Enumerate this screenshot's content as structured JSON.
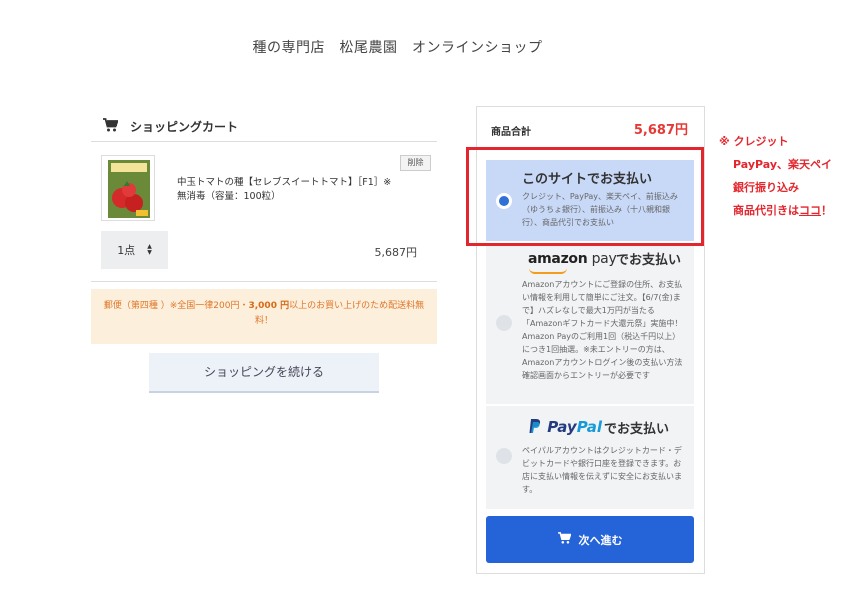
{
  "store": {
    "title": "種の専門店　松尾農園　オンラインショップ"
  },
  "cart": {
    "title": "ショッピングカート",
    "item": {
      "name": "中玉トマトの種【セレブスイートトマト】［F1］※無消毒（容量：100粒）",
      "delete_label": "削除",
      "quantity": "1点",
      "price": "5,687円"
    },
    "shipping_note_pre": "郵便（第四種 ）※全国一律200円・",
    "shipping_note_bold": "3,000 円",
    "shipping_note_post": "以上のお買い上げのため配送料無料！",
    "continue_label": "ショッピングを続ける"
  },
  "summary": {
    "subtotal_label": "商品合計",
    "subtotal_value": "5,687円"
  },
  "payment": {
    "site": {
      "heading": "このサイトでお支払い",
      "description": "クレジット、PayPay、楽天ペイ、前振込み（ゆうちょ銀行）、前振込み（十八親和銀行）、商品代引でお支払い",
      "selected": true
    },
    "amazon": {
      "logo_amazon": "amazon",
      "logo_pay": " pay",
      "heading": "でお支払い",
      "description": "Amazonアカウントにご登録の住所、お支払い情報を利用して簡単にご注文。【6/7(金)まで】ハズレなしで最大1万円が当たる「Amazonギフトカード大還元祭」実施中！Amazon Payのご利用1回（税込千円以上）につき1回抽選。※未エントリーの方は、Amazonアカウントログイン後の支払い方法確認画面からエントリーが必要です",
      "selected": false
    },
    "paypal": {
      "logo_pay": "Pay",
      "logo_pal": "Pal",
      "heading": "でお支払い",
      "description": "ペイパルアカウントはクレジットカード・デビットカードや銀行口座を登録できます。お店に支払い情報を伝えずに安全にお支払います。",
      "selected": false
    },
    "next_label": "次へ進む"
  },
  "annotation": {
    "line1": "※ クレジット",
    "line2": "PayPay、楽天ペイ",
    "line3": "銀行振り込み",
    "line4_pre": "商品代引きは",
    "line4_link": "ココ",
    "line4_post": "！",
    "color": "#e3262d"
  },
  "colors": {
    "accent": "#2563d8",
    "price": "#e53935",
    "shipping_text": "#e0772a",
    "selected_option_bg": "#c8d9f7"
  }
}
